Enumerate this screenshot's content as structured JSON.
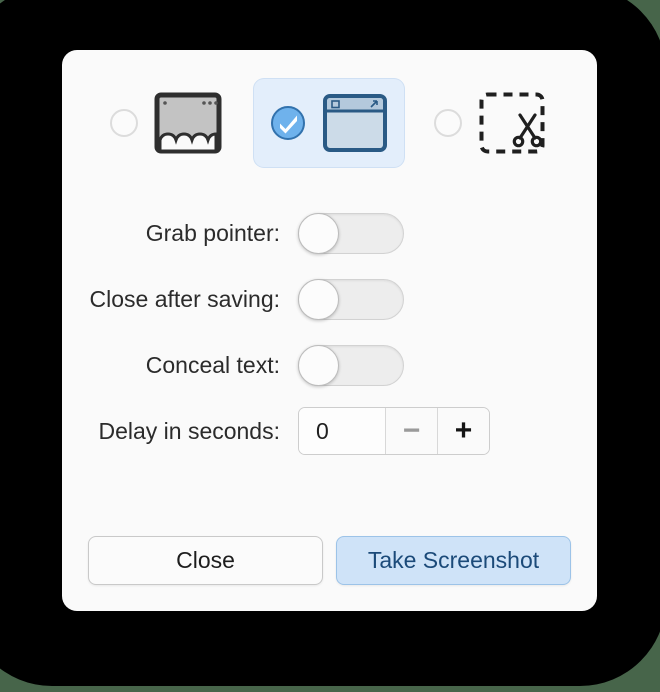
{
  "window": {
    "background_color": "#47654a",
    "dialog_background": "#fafafa"
  },
  "mode_selector": {
    "options": [
      {
        "id": "screen",
        "name": "whole-screen",
        "icon": "screen-icon",
        "selected": false,
        "radio_state": "unchecked"
      },
      {
        "id": "window",
        "name": "current-window",
        "icon": "window-icon",
        "selected": true,
        "radio_state": "checked"
      },
      {
        "id": "selection",
        "name": "selection-area",
        "icon": "scissors-selection-icon",
        "selected": false,
        "radio_state": "unchecked"
      }
    ],
    "selected_accent": "#3b84dd",
    "selected_tile_bg": "#e3eefb"
  },
  "options": {
    "rows": [
      {
        "label": "Grab pointer:",
        "name": "grab-pointer",
        "state": "off"
      },
      {
        "label": "Close after saving:",
        "name": "close-after-saving",
        "state": "off"
      },
      {
        "label": "Conceal text:",
        "name": "conceal-text",
        "state": "off"
      }
    ],
    "delay": {
      "label": "Delay in seconds:",
      "value": "0",
      "placeholder": "0",
      "decrement_label": "−",
      "increment_label": "+",
      "decrement_enabled": false,
      "increment_enabled": true
    }
  },
  "footer": {
    "close_label": "Close",
    "take_screenshot_label": "Take Screenshot",
    "take_screenshot_accent": "#cfe3f8"
  }
}
